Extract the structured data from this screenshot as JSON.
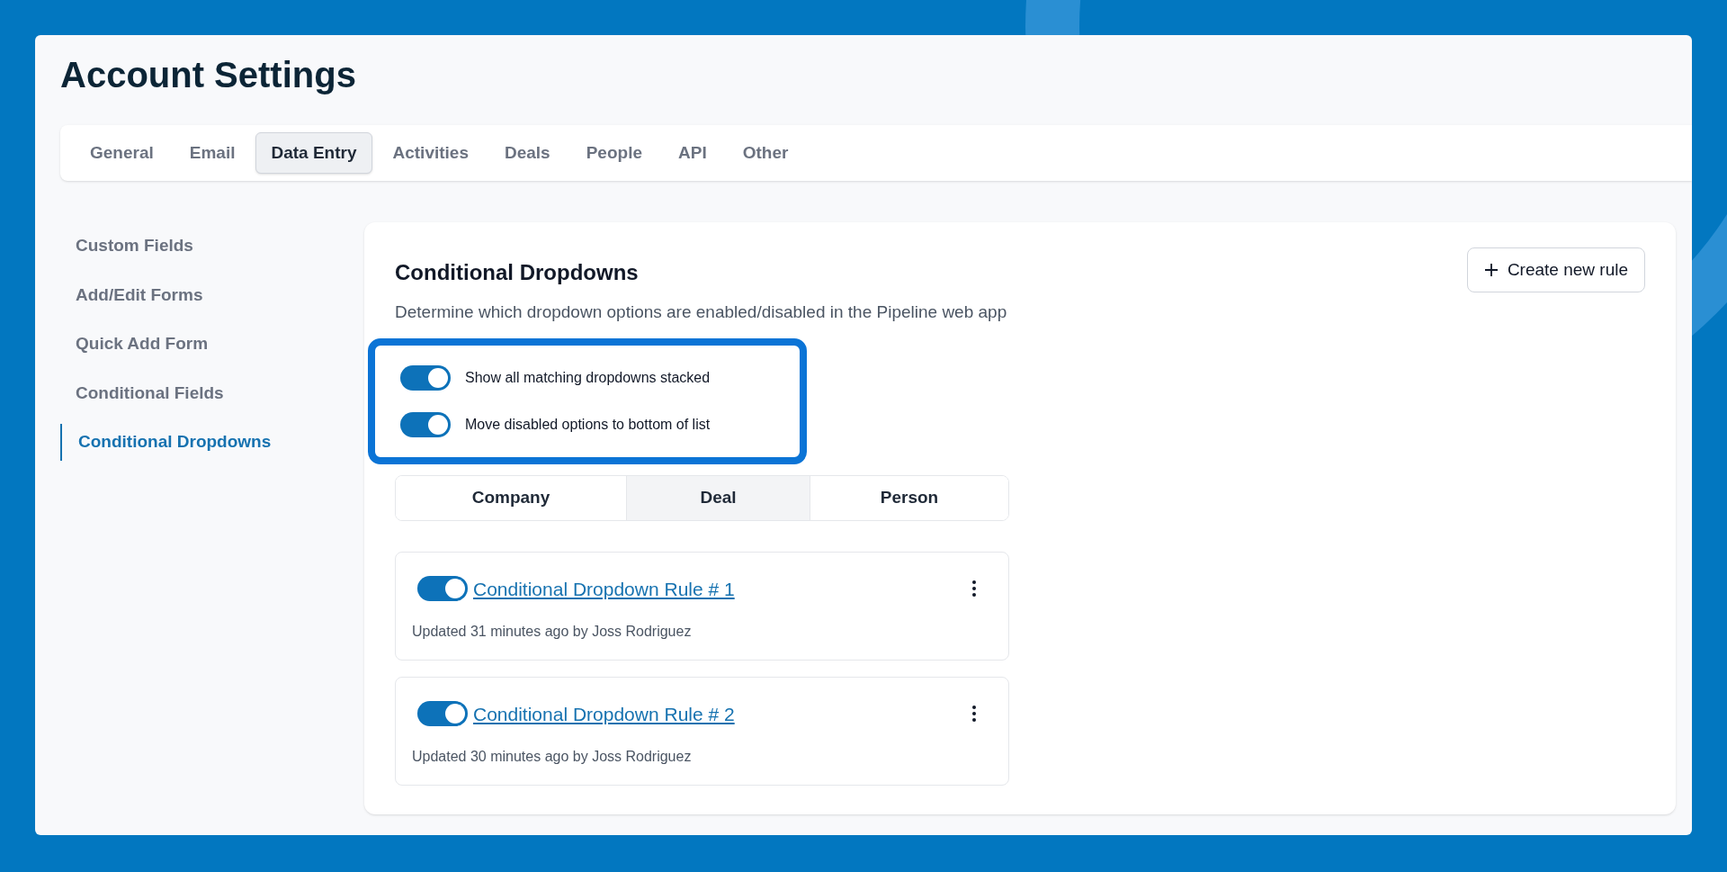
{
  "page": {
    "title": "Account Settings"
  },
  "tabs": [
    {
      "label": "General",
      "selected": false
    },
    {
      "label": "Email",
      "selected": false
    },
    {
      "label": "Data Entry",
      "selected": true
    },
    {
      "label": "Activities",
      "selected": false
    },
    {
      "label": "Deals",
      "selected": false
    },
    {
      "label": "People",
      "selected": false
    },
    {
      "label": "API",
      "selected": false
    },
    {
      "label": "Other",
      "selected": false
    }
  ],
  "sidebar": {
    "items": [
      {
        "label": "Custom Fields",
        "selected": false
      },
      {
        "label": "Add/Edit Forms",
        "selected": false
      },
      {
        "label": "Quick Add Form",
        "selected": false
      },
      {
        "label": "Conditional Fields",
        "selected": false
      },
      {
        "label": "Conditional Dropdowns",
        "selected": true
      }
    ]
  },
  "panel": {
    "title": "Conditional Dropdowns",
    "description": "Determine which dropdown options are enabled/disabled in the Pipeline web app",
    "create_button": "Create new rule",
    "options": [
      {
        "label": "Show all matching dropdowns stacked",
        "on": true
      },
      {
        "label": "Move disabled options to bottom of list",
        "on": true
      }
    ],
    "segments": [
      {
        "label": "Company",
        "selected": false
      },
      {
        "label": "Deal",
        "selected": true
      },
      {
        "label": "Person",
        "selected": false
      }
    ],
    "rules": [
      {
        "name": "Conditional Dropdown Rule # 1",
        "on": true,
        "updated": "Updated 31 minutes ago by Joss Rodriguez"
      },
      {
        "name": "Conditional Dropdown Rule # 2",
        "on": true,
        "updated": "Updated 30 minutes ago by Joss Rodriguez"
      }
    ]
  }
}
